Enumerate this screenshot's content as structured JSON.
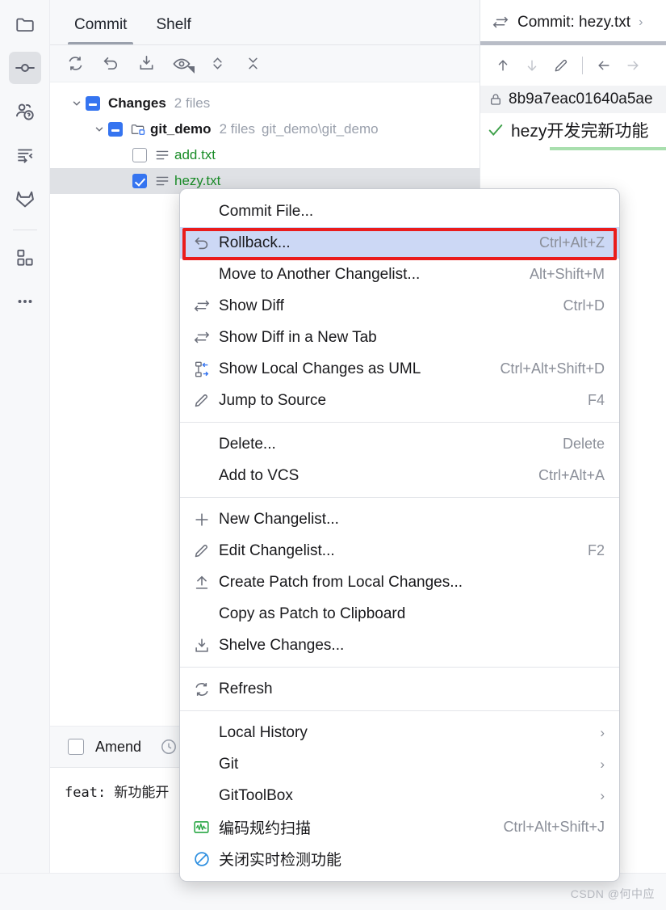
{
  "activitybar": {
    "items": [
      {
        "name": "project",
        "icon": "folder-icon",
        "selected": false
      },
      {
        "name": "commit",
        "icon": "commit-node-icon",
        "selected": true
      },
      {
        "name": "pull-requests",
        "icon": "pull-request-icon",
        "selected": false
      },
      {
        "name": "structure",
        "icon": "structure-icon",
        "selected": false
      },
      {
        "name": "gitlab",
        "icon": "gitlab-icon",
        "selected": false
      },
      {
        "name": "plugins",
        "icon": "plugins-grid-icon",
        "selected": false
      },
      {
        "name": "more",
        "icon": "more-dots-icon",
        "selected": false
      }
    ]
  },
  "commit_panel": {
    "tabs": [
      {
        "label": "Commit",
        "active": true
      },
      {
        "label": "Shelf",
        "active": false
      }
    ],
    "toolbar": [
      {
        "name": "refresh-button",
        "icon": "refresh-icon"
      },
      {
        "name": "rollback-button",
        "icon": "rollback-icon"
      },
      {
        "name": "shelve-button",
        "icon": "shelve-icon"
      },
      {
        "name": "preview-diff-button",
        "icon": "eye-icon"
      },
      {
        "name": "expand-collapse-button",
        "icon": "expand-collapse-icon"
      },
      {
        "name": "collapse-all-button",
        "icon": "collapse-all-icon"
      }
    ],
    "tree": {
      "changelist": {
        "label": "Changes",
        "meta": "2 files",
        "checkbox": "partial",
        "expanded": true
      },
      "directory": {
        "label": "git_demo",
        "meta_count": "2 files",
        "meta_path": "git_demo\\git_demo",
        "checkbox": "partial",
        "expanded": true
      },
      "files": [
        {
          "label": "add.txt",
          "checkbox": "unchecked",
          "selected": false,
          "status": "added"
        },
        {
          "label": "hezy.txt",
          "checkbox": "checked",
          "selected": true,
          "status": "added"
        }
      ]
    },
    "amend": {
      "label": "Amend",
      "checked": false,
      "history_icon": "clock-icon"
    },
    "commit_message": "feat: 新功能开"
  },
  "right_panel": {
    "tab_title": "Commit: hezy.txt",
    "tab_icon": "diff-icon",
    "toolbar": [
      {
        "name": "previous-difference-button",
        "icon": "arrow-up-icon"
      },
      {
        "name": "next-difference-button",
        "icon": "arrow-down-icon"
      },
      {
        "name": "edit-source-button",
        "icon": "pencil-icon"
      },
      {
        "name": "back-button",
        "icon": "arrow-left-icon"
      },
      {
        "name": "forward-button",
        "icon": "arrow-right-icon"
      }
    ],
    "commit_hash": "8b9a7eac01640a5ae",
    "commit_hash_icon": "lock-icon",
    "commit_message": "hezy开发完新功能",
    "commit_message_icon": "check-green-icon"
  },
  "context_menu": {
    "groups": [
      {
        "items": [
          {
            "label": "Commit File...",
            "mnemonic": "i",
            "accel": "",
            "icon": "",
            "submenu": false,
            "highlighted": false
          },
          {
            "label": "Rollback...",
            "mnemonic": "R",
            "accel": "Ctrl+Alt+Z",
            "icon": "rollback-icon",
            "submenu": false,
            "highlighted": true
          },
          {
            "label": "Move to Another Changelist...",
            "mnemonic": "",
            "accel": "Alt+Shift+M",
            "icon": "",
            "submenu": false,
            "highlighted": false
          },
          {
            "label": "Show Diff",
            "mnemonic": "",
            "accel": "Ctrl+D",
            "icon": "diff-icon",
            "submenu": false,
            "highlighted": false
          },
          {
            "label": "Show Diff in a New Tab",
            "mnemonic": "",
            "accel": "",
            "icon": "diff-icon",
            "submenu": false,
            "highlighted": false
          },
          {
            "label": "Show Local Changes as UML",
            "mnemonic": "",
            "accel": "Ctrl+Alt+Shift+D",
            "icon": "uml-icon",
            "submenu": false,
            "highlighted": false
          },
          {
            "label": "Jump to Source",
            "mnemonic": "J",
            "accel": "F4",
            "icon": "pencil-icon",
            "submenu": false,
            "highlighted": false
          }
        ]
      },
      {
        "items": [
          {
            "label": "Delete...",
            "mnemonic": "D",
            "accel": "Delete",
            "icon": "",
            "submenu": false,
            "highlighted": false
          },
          {
            "label": "Add to VCS",
            "mnemonic": "",
            "accel": "Ctrl+Alt+A",
            "icon": "",
            "submenu": false,
            "highlighted": false
          }
        ]
      },
      {
        "items": [
          {
            "label": "New Changelist...",
            "mnemonic": "",
            "accel": "",
            "icon": "plus-icon",
            "submenu": false,
            "highlighted": false
          },
          {
            "label": "Edit Changelist...",
            "mnemonic": "",
            "accel": "F2",
            "icon": "pencil-icon",
            "submenu": false,
            "highlighted": false
          },
          {
            "label": "Create Patch from Local Changes...",
            "mnemonic": "",
            "accel": "",
            "icon": "patch-icon",
            "submenu": false,
            "highlighted": false
          },
          {
            "label": "Copy as Patch to Clipboard",
            "mnemonic": "",
            "accel": "",
            "icon": "",
            "submenu": false,
            "highlighted": false
          },
          {
            "label": "Shelve Changes...",
            "mnemonic": "",
            "accel": "",
            "icon": "shelve-icon",
            "submenu": false,
            "highlighted": false
          }
        ]
      },
      {
        "items": [
          {
            "label": "Refresh",
            "mnemonic": "",
            "accel": "",
            "icon": "refresh-icon",
            "submenu": false,
            "highlighted": false
          }
        ]
      },
      {
        "items": [
          {
            "label": "Local History",
            "mnemonic": "H",
            "accel": "",
            "icon": "",
            "submenu": true,
            "highlighted": false
          },
          {
            "label": "Git",
            "mnemonic": "G",
            "accel": "",
            "icon": "",
            "submenu": true,
            "highlighted": false
          },
          {
            "label": "GitToolBox",
            "mnemonic": "",
            "accel": "",
            "icon": "",
            "submenu": true,
            "highlighted": false
          },
          {
            "label": "编码规约扫描",
            "mnemonic": "",
            "accel": "Ctrl+Alt+Shift+J",
            "icon": "alibaba-scan-icon",
            "submenu": false,
            "highlighted": false
          },
          {
            "label": "关闭实时检测功能",
            "mnemonic": "",
            "accel": "",
            "icon": "disable-icon",
            "submenu": false,
            "highlighted": false
          }
        ]
      }
    ]
  },
  "annotation": {
    "highlight_color": "#ea1c1c",
    "selection_color": "#ccd8f5",
    "accent_color": "#3574f0"
  },
  "watermark": "CSDN @何中应"
}
